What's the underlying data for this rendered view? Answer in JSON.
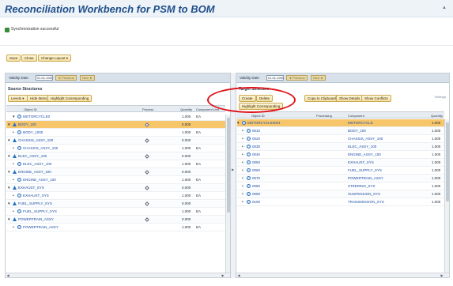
{
  "app": {
    "title": "Reconciliation Workbench for PSM to BOM",
    "menu_icon": "menu-icon"
  },
  "message": {
    "icon": "success-icon",
    "text": "Synchronization successful"
  },
  "toolbar": {
    "save": "Save",
    "close": "Close",
    "change_layout": "Change Layout ▾"
  },
  "left_pane": {
    "validity_label": "Validity Date",
    "validity_value": "01.01.1900",
    "prev_btn": "◄ Previous",
    "next_btn": "Next ►",
    "section_title": "Source Structures",
    "buttons": {
      "levels": "Levels ▾",
      "hide_items": "Hide Items",
      "highlight": "Highlight Corresponding"
    },
    "columns": [
      "Object ID",
      "Process",
      "Quantity",
      "Component Unit"
    ],
    "rows": [
      {
        "expander": "▾",
        "type": "item",
        "label": "MOTORCYCLE0",
        "process": false,
        "qty": "1.000",
        "unit": "EA",
        "hl": false
      },
      {
        "expander": "▾",
        "type": "mat",
        "label": "BODY_100",
        "process": true,
        "qty": "0.000",
        "unit": "",
        "hl": true
      },
      {
        "expander": "•",
        "type": "item",
        "label": "BODY_1000",
        "process": false,
        "qty": "1.000",
        "unit": "EA",
        "hl": false
      },
      {
        "expander": "▾",
        "type": "mat",
        "label": "CHASSIS_ASSY_100",
        "process": true,
        "qty": "0.000",
        "unit": "",
        "hl": false
      },
      {
        "expander": "•",
        "type": "item",
        "label": "CHASSIS_ASSY_100",
        "process": false,
        "qty": "1.000",
        "unit": "EA",
        "hl": false
      },
      {
        "expander": "▾",
        "type": "mat",
        "label": "ELEC_ASSY_100",
        "process": true,
        "qty": "0.000",
        "unit": "",
        "hl": false
      },
      {
        "expander": "•",
        "type": "item",
        "label": "ELEC_ASSY_100",
        "process": false,
        "qty": "1.000",
        "unit": "EA",
        "hl": false
      },
      {
        "expander": "▾",
        "type": "mat",
        "label": "ENGINE_ASSY_100",
        "process": true,
        "qty": "0.000",
        "unit": "",
        "hl": false
      },
      {
        "expander": "•",
        "type": "item",
        "label": "ENGINE_ASSY_100",
        "process": false,
        "qty": "1.000",
        "unit": "EA",
        "hl": false
      },
      {
        "expander": "▾",
        "type": "mat",
        "label": "EXHAUST_SYS",
        "process": true,
        "qty": "0.000",
        "unit": "",
        "hl": false
      },
      {
        "expander": "•",
        "type": "item",
        "label": "EXHAUST_SYS",
        "process": false,
        "qty": "1.000",
        "unit": "EA",
        "hl": false
      },
      {
        "expander": "▾",
        "type": "mat",
        "label": "FUEL_SUPPLY_SYS",
        "process": true,
        "qty": "0.000",
        "unit": "",
        "hl": false
      },
      {
        "expander": "•",
        "type": "item",
        "label": "FUEL_SUPPLY_SYS",
        "process": false,
        "qty": "1.000",
        "unit": "EA",
        "hl": false
      },
      {
        "expander": "▾",
        "type": "mat",
        "label": "POWERTRAIN_ASSY",
        "process": true,
        "qty": "0.000",
        "unit": "",
        "hl": false
      },
      {
        "expander": "•",
        "type": "item",
        "label": "POWERTRAIN_ASSY",
        "process": false,
        "qty": "1.000",
        "unit": "EA",
        "hl": false
      }
    ]
  },
  "right_pane": {
    "validity_label": "Validity Date",
    "validity_value": "01.01.1900",
    "prev_btn": "◄ Previous",
    "next_btn": "Next ►",
    "section_title": "Target Structure",
    "buttons": {
      "create": "Create",
      "delete": "Delete",
      "copy": "Copy to Clipboard",
      "show_details": "Show Details",
      "show_conflicts": "Show Conflicts",
      "highlight": "Highlight Corresponding"
    },
    "settings": "Settings",
    "columns": [
      "Object ID",
      "Processing",
      "Component",
      "Quantity"
    ],
    "rows": [
      {
        "expander": "▾",
        "id": "MOTORCYCLE0001",
        "component": "MOTORCYCLE",
        "qty": "1.000",
        "hl": true
      },
      {
        "expander": "•",
        "id": "0010",
        "component": "BODY_100",
        "qty": "1.000",
        "hl": false
      },
      {
        "expander": "•",
        "id": "0020",
        "component": "CHASSIS_ASSY_100",
        "qty": "1.000",
        "hl": false
      },
      {
        "expander": "•",
        "id": "0030",
        "component": "ELEC_ASSY_100",
        "qty": "1.000",
        "hl": false
      },
      {
        "expander": "•",
        "id": "0040",
        "component": "ENGINE_ASSY_100",
        "qty": "1.000",
        "hl": false
      },
      {
        "expander": "•",
        "id": "0050",
        "component": "EXHAUST_SYS",
        "qty": "1.000",
        "hl": false
      },
      {
        "expander": "•",
        "id": "0060",
        "component": "FUEL_SUPPLY_SYS",
        "qty": "1.000",
        "hl": false
      },
      {
        "expander": "•",
        "id": "0070",
        "component": "POWERTRAIN_ASSY",
        "qty": "1.000",
        "hl": false
      },
      {
        "expander": "•",
        "id": "0080",
        "component": "STEERING_SYS",
        "qty": "1.000",
        "hl": false
      },
      {
        "expander": "•",
        "id": "0090",
        "component": "SUSPENSION_SYS",
        "qty": "1.000",
        "hl": false
      },
      {
        "expander": "•",
        "id": "0100",
        "component": "TRANSMISSION_SYS",
        "qty": "1.000",
        "hl": false
      }
    ]
  },
  "colors": {
    "highlight_row": "#f7c66a",
    "annotation": "#e0131b",
    "link": "#1d4fa8"
  }
}
